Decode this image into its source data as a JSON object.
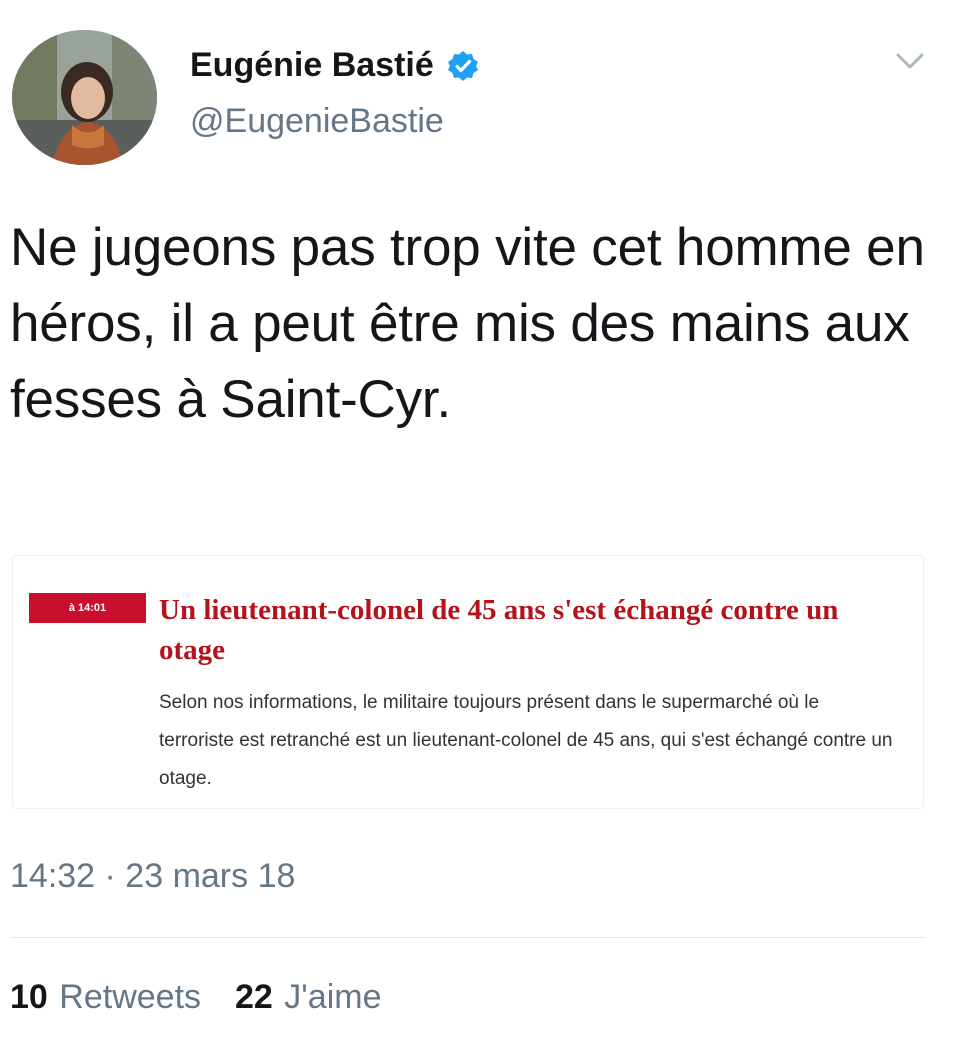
{
  "author": {
    "display_name": "Eugénie Bastié",
    "handle": "@EugenieBastie",
    "verified": true,
    "avatar_icon": "profile-photo"
  },
  "tweet": {
    "text": "Ne jugeons pas trop vite cet homme en héros, il a peut être mis des mains aux fesses à Saint-Cyr."
  },
  "card": {
    "time_badge": "à 14:01",
    "headline": "Un lieutenant-colonel de 45 ans s'est échangé contre un otage",
    "body": "Selon nos informations, le militaire toujours présent dans le supermarché où le terroriste est retranché est un lieutenant-colonel de 45 ans, qui s'est échangé contre un otage."
  },
  "meta": {
    "timestamp": "14:32 · 23 mars 18"
  },
  "stats": {
    "retweets_count": "10",
    "retweets_label": "Retweets",
    "likes_count": "22",
    "likes_label": "J'aime"
  },
  "colors": {
    "verified_blue": "#1da1f2",
    "headline_red": "#b5121b",
    "badge_red": "#c8102e",
    "secondary_text": "#657786"
  },
  "icons": {
    "verified": "verified-badge-icon",
    "menu": "chevron-down-icon"
  }
}
